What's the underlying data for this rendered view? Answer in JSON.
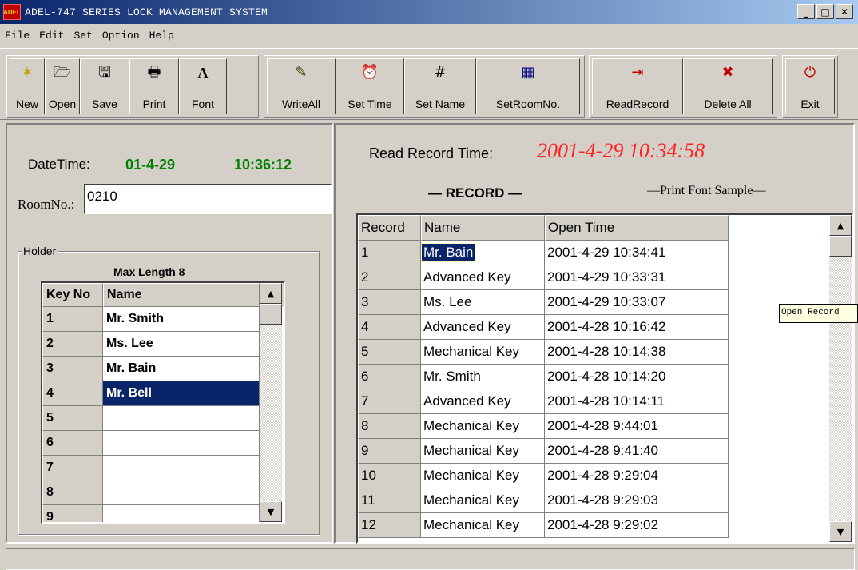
{
  "window": {
    "title": "ADEL-747 SERIES LOCK MANAGEMENT SYSTEM",
    "icon": "adel-app-icon",
    "controls": {
      "minimize": "_",
      "maximize": "□",
      "close": "✕"
    }
  },
  "menu": [
    "File",
    "Edit",
    "Set",
    "Option",
    "Help"
  ],
  "toolbar": {
    "new": {
      "label": "New",
      "icon": "✶"
    },
    "open": {
      "label": "Open",
      "icon": "🗁"
    },
    "save": {
      "label": "Save",
      "icon": "🖫"
    },
    "print": {
      "label": "Print",
      "icon": "🖶"
    },
    "font": {
      "label": "Font",
      "icon": "A"
    },
    "writeall": {
      "label": "WriteAll",
      "icon": "✎"
    },
    "settime": {
      "label": "Set Time",
      "icon": "⏰"
    },
    "setname": {
      "label": "Set Name",
      "icon": "#"
    },
    "setroomno": {
      "label": "SetRoomNo.",
      "icon": "▦"
    },
    "readrecord": {
      "label": "ReadRecord",
      "icon": "⇥"
    },
    "deleteall": {
      "label": "Delete All",
      "icon": "✖"
    },
    "exit": {
      "label": "Exit",
      "icon": "⏻"
    }
  },
  "left": {
    "datetime_label": "DateTime:",
    "date": "01-4-29",
    "time": "10:36:12",
    "room_label": "RoomNo.:",
    "room_value": "0210",
    "holder_legend": "Holder",
    "max_length": "Max Length 8",
    "holder_headers": [
      "Key No",
      "Name"
    ],
    "holders": [
      {
        "key": "1",
        "name": "Mr. Smith"
      },
      {
        "key": "2",
        "name": "Ms. Lee"
      },
      {
        "key": "3",
        "name": "Mr. Bain"
      },
      {
        "key": "4",
        "name": "Mr. Bell"
      },
      {
        "key": "5",
        "name": ""
      },
      {
        "key": "6",
        "name": ""
      },
      {
        "key": "7",
        "name": ""
      },
      {
        "key": "8",
        "name": ""
      },
      {
        "key": "9",
        "name": ""
      }
    ],
    "selected_holder": "4"
  },
  "right": {
    "read_record_label": "Read Record Time:",
    "read_record_time": "2001-4-29  10:34:58",
    "record_title": "— RECORD —",
    "print_font_sample": "—Print Font Sample—",
    "record_headers": [
      "Record",
      "Name",
      "Open Time"
    ],
    "records": [
      {
        "no": "1",
        "name": "Mr. Bain",
        "time": "2001-4-29  10:34:41"
      },
      {
        "no": "2",
        "name": "Advanced Key",
        "time": "2001-4-29  10:33:31"
      },
      {
        "no": "3",
        "name": "Ms. Lee",
        "time": "2001-4-29  10:33:07"
      },
      {
        "no": "4",
        "name": "Advanced Key",
        "time": "2001-4-28  10:16:42"
      },
      {
        "no": "5",
        "name": "Mechanical Key",
        "time": "2001-4-28  10:14:38"
      },
      {
        "no": "6",
        "name": "Mr. Smith",
        "time": "2001-4-28  10:14:20"
      },
      {
        "no": "7",
        "name": "Advanced Key",
        "time": "2001-4-28  10:14:11"
      },
      {
        "no": "8",
        "name": "Mechanical Key",
        "time": "2001-4-28  9:44:01"
      },
      {
        "no": "9",
        "name": "Mechanical Key",
        "time": "2001-4-28  9:41:40"
      },
      {
        "no": "10",
        "name": "Mechanical Key",
        "time": "2001-4-28  9:29:04"
      },
      {
        "no": "11",
        "name": "Mechanical Key",
        "time": "2001-4-28  9:29:03"
      },
      {
        "no": "12",
        "name": "Mechanical Key",
        "time": "2001-4-28  9:29:02"
      }
    ],
    "selected_record": "1",
    "tooltip": "Open Record"
  },
  "colors": {
    "title_bar": "#0a246a",
    "selection": "#0a246a",
    "datetime_green": "#008000",
    "read_time_red": "#ff2020",
    "face": "#d4d0c8"
  }
}
